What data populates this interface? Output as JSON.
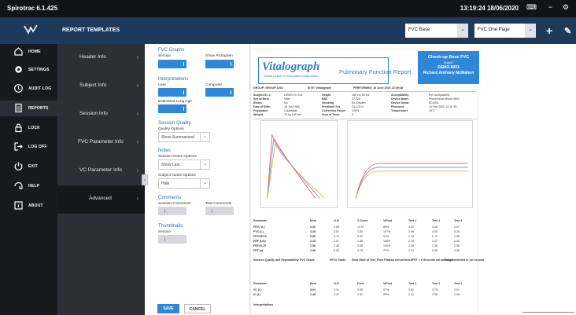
{
  "app": {
    "title": "Spirotrac 6.1.425",
    "clock": "13:19:24 18/06/2020"
  },
  "window_controls": {
    "keyboard": "⌨",
    "minimize": "−",
    "settings": "⚙"
  },
  "header": {
    "title": "REPORT TEMPLATES",
    "select_test": "FVC Base",
    "select_layout": "FVC One Page",
    "add_icon": "+",
    "edit_icon": "✎"
  },
  "nav": {
    "items": [
      {
        "label": "HOME",
        "icon": "home-icon"
      },
      {
        "label": "SETTINGS",
        "icon": "gear-icon"
      },
      {
        "label": "AUDIT LOG",
        "icon": "clock-icon"
      },
      {
        "label": "REPORTS",
        "icon": "document-icon"
      },
      {
        "label": "LOCK",
        "icon": "lock-icon"
      },
      {
        "label": "LOG OFF",
        "icon": "logoff-icon"
      },
      {
        "label": "EXIT",
        "icon": "power-icon"
      },
      {
        "label": "HELP",
        "icon": "help-icon"
      },
      {
        "label": "ABOUT",
        "icon": "about-icon"
      }
    ],
    "active": "REPORTS"
  },
  "templates": {
    "items": [
      {
        "label": "Header Info"
      },
      {
        "label": "Subject Info"
      },
      {
        "label": "Session Info"
      },
      {
        "label": "FVC Parameter Info"
      },
      {
        "label": "VC Parameter Info"
      },
      {
        "label": "Advanced"
      }
    ],
    "selected": "Advanced",
    "chevron": "›",
    "collapse": "‹"
  },
  "settings": {
    "fvc_graphs": {
      "title": "FVC Graphs",
      "section_label": "Section",
      "section_on": true,
      "show_pictogram_label": "Show Pictogram",
      "show_pictogram_on": true
    },
    "interpretations": {
      "title": "Interpretations",
      "user_label": "User",
      "user_on": true,
      "computer_label": "Computer",
      "computer_on": true,
      "estimated_lung_age_label": "Estimated Lung Age",
      "estimated_lung_age_on": true
    },
    "session_quality": {
      "title": "Session Quality",
      "quality_options_label": "Quality Options",
      "quality_options_value": "Show Summarised"
    },
    "notes": {
      "title": "Notes",
      "session_notes_label": "Session Notes Options",
      "session_notes_value": "Show Last",
      "subject_notes_label": "Subject Notes Options",
      "subject_notes_value": "Hide"
    },
    "comments": {
      "title": "Comments",
      "session_comments_label": "Session Comments",
      "session_comments_on": false,
      "test_comments_label": "Test Comments",
      "test_comments_on": false
    },
    "thumbnails": {
      "title": "Thumbnails",
      "section_label": "Section",
      "section_on": false
    },
    "save_label": "SAVE",
    "cancel_label": "CANCEL",
    "caret": "⌄"
  },
  "report": {
    "brand": "Vitalograph",
    "brand_tag": "Global Leader in Respiratory Diagnostics",
    "title": "Pulmonary Function Report",
    "blue_box": {
      "line1": "Check-up Base FVC",
      "line2": "Subject",
      "line3": "DEMO-0001",
      "line4": "Richard Anthony McMahon"
    },
    "info_rows": [
      [
        "GROUP: GROUP-1002",
        "SITE: Vitalograph",
        "PERFORMED: 18 June 2020 13:09:48"
      ],
      [
        "Subject ID: 2",
        "DEMO-H-7341",
        "Height",
        "165 cm 65 ins",
        "Acceptability",
        "Per Acceptability"
      ],
      [
        "Sex at Birth",
        "Male",
        "BMI",
        "27.325",
        "Device Name",
        "Pneumotrac Model 6800"
      ],
      [
        "Ethnic",
        "No",
        "Smoking",
        "Ex-Smoker",
        "Device Serial",
        "9C4501"
      ],
      [
        "Date of Birth",
        "18 Jun 1990",
        "Predicted Set",
        "GLI-2012",
        "Recorded",
        "10 Feb 2020 13:10:39"
      ],
      [
        "Population",
        "Caucasian",
        "Correction Factor",
        "100%",
        "Temperature",
        "18°C"
      ],
      [
        "Weight",
        "75 kg 165 lbs",
        "Num of Tests",
        "3",
        "",
        ""
      ]
    ],
    "table_headers": [
      "Parameter",
      "Best",
      "LLN",
      "Z-Score",
      "%Pred",
      "Test 1",
      "Test 2",
      "Test 3"
    ],
    "fvc_rows": [
      [
        "FEV1 (L)",
        "3.36",
        "2.89",
        "-0.74",
        "89%",
        "3.52",
        "3.36",
        "3.07"
      ],
      [
        "FVC (L)",
        "4.35",
        "3.61",
        "1.50",
        "107%",
        "3.98",
        "4.35",
        "4.28"
      ],
      [
        "FEV1/FVC",
        "0.85",
        "0.72",
        "0.92",
        "94%",
        "1.78",
        "0.72",
        "0.85"
      ],
      [
        "PEF (L/s)",
        "2.15",
        "2.07",
        "1.48",
        "108%",
        "2.15",
        "2.07",
        "2.25"
      ],
      [
        "FEF25-75",
        "2.58",
        "2.48",
        "4.98",
        "150%",
        "2.45",
        "2.35",
        "2.58"
      ],
      [
        "FET (s)",
        "2.98",
        "9.00",
        "4.25",
        "79%",
        "2.21",
        "2.98",
        "2.98"
      ]
    ],
    "quality_header": [
      "Session Quality and Repeatability",
      "FVC Grade",
      "FEV1 Grade",
      "Slow Start of Test",
      "Flow Plateau not achieved",
      "FET < 6 Seconds not achieved",
      "Cough detected in 1st second"
    ],
    "vc_header": [
      "Parameter",
      "Best",
      "LLN",
      "Pred",
      "%Pred",
      "Test 1",
      "Test 2",
      "Test 3"
    ],
    "vc_rows": [
      [
        "VC (L)",
        "3.91",
        "3.31",
        "3.95",
        "97%",
        "3.61",
        "3.78",
        "3.91"
      ],
      [
        "IC (L)",
        "2.48",
        "2.22",
        "2.52",
        "99%",
        "2.41",
        "2.36",
        "2.48"
      ]
    ],
    "interpretations_label": "Interpretations"
  },
  "colors": {
    "accent": "#2f87d8",
    "nav_bg": "#17191c",
    "header_bg": "#1d3a5c",
    "template_bg": "#2c3036"
  }
}
